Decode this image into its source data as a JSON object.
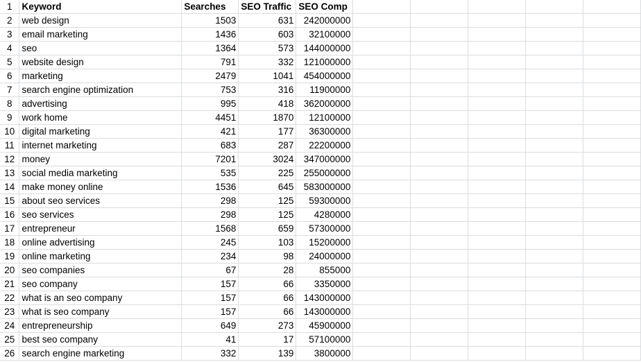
{
  "sheet": {
    "headers": [
      "Keyword",
      "Searches",
      "SEO Traffic",
      "SEO Comp"
    ],
    "row_numbers": [
      "1",
      "2",
      "3",
      "4",
      "5",
      "6",
      "7",
      "8",
      "9",
      "10",
      "11",
      "12",
      "13",
      "14",
      "15",
      "16",
      "17",
      "18",
      "19",
      "20",
      "21",
      "22",
      "23",
      "24",
      "25",
      "26"
    ],
    "rows": [
      [
        "web design",
        "1503",
        "631",
        "242000000"
      ],
      [
        "email marketing",
        "1436",
        "603",
        "32100000"
      ],
      [
        "seo",
        "1364",
        "573",
        "144000000"
      ],
      [
        "website design",
        "791",
        "332",
        "121000000"
      ],
      [
        "marketing",
        "2479",
        "1041",
        "454000000"
      ],
      [
        "search engine optimization",
        "753",
        "316",
        "11900000"
      ],
      [
        "advertising",
        "995",
        "418",
        "362000000"
      ],
      [
        "work home",
        "4451",
        "1870",
        "12100000"
      ],
      [
        "digital marketing",
        "421",
        "177",
        "36300000"
      ],
      [
        "internet marketing",
        "683",
        "287",
        "22200000"
      ],
      [
        "money",
        "7201",
        "3024",
        "347000000"
      ],
      [
        "social media marketing",
        "535",
        "225",
        "255000000"
      ],
      [
        "make money online",
        "1536",
        "645",
        "583000000"
      ],
      [
        "about seo services",
        "298",
        "125",
        "59300000"
      ],
      [
        "seo services",
        "298",
        "125",
        "4280000"
      ],
      [
        "entrepreneur",
        "1568",
        "659",
        "57300000"
      ],
      [
        "online advertising",
        "245",
        "103",
        "15200000"
      ],
      [
        "online marketing",
        "234",
        "98",
        "24000000"
      ],
      [
        "seo companies",
        "67",
        "28",
        "855000"
      ],
      [
        "seo company",
        "157",
        "66",
        "3350000"
      ],
      [
        "what is an seo company",
        "157",
        "66",
        "143000000"
      ],
      [
        "what is seo company",
        "157",
        "66",
        "143000000"
      ],
      [
        "entrepreneurship",
        "649",
        "273",
        "45900000"
      ],
      [
        "best seo company",
        "41",
        "17",
        "57100000"
      ],
      [
        "search engine marketing",
        "332",
        "139",
        "3800000"
      ]
    ],
    "colors": {
      "gridline": "#dadcdf",
      "text": "#000000",
      "background": "#ffffff"
    }
  }
}
